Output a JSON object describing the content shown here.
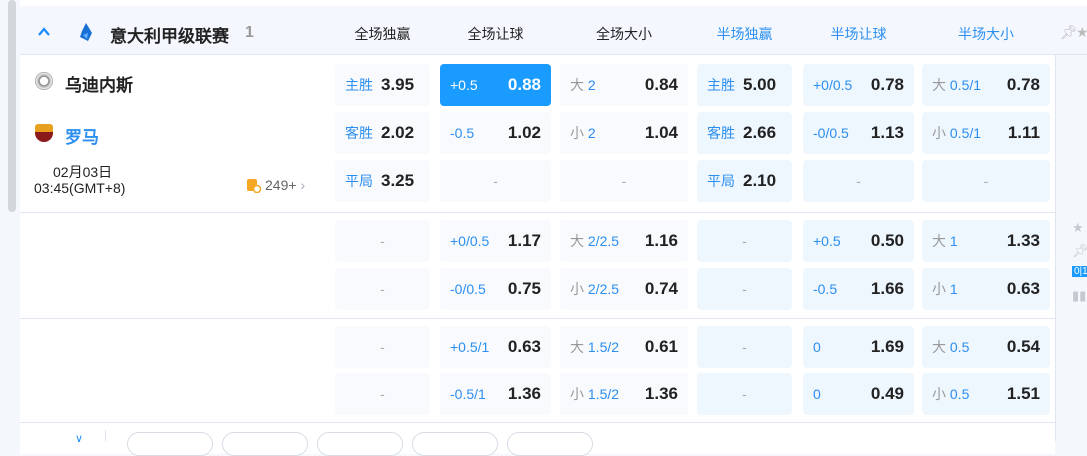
{
  "league": {
    "name": "意大利甲级联赛",
    "count": "1"
  },
  "columns": [
    "全场独赢",
    "全场让球",
    "全场大小",
    "半场独赢",
    "半场让球",
    "半场大小"
  ],
  "match": {
    "home": "乌迪内斯",
    "away": "罗马",
    "date": "02月03日",
    "time": "03:45(GMT+8)",
    "more_count": "249+"
  },
  "colors": {
    "accent": "#1a9bff",
    "label": "#2c8ff0",
    "away_team": "#2c8ff0"
  },
  "rows": [
    [
      {
        "lab": "主胜",
        "val": "3.95"
      },
      {
        "lab": "+0.5",
        "val": "0.88",
        "selected": true
      },
      {
        "pre": "大",
        "lab": "2",
        "val": "0.84"
      },
      {
        "lab": "主胜",
        "val": "5.00"
      },
      {
        "lab": "+0/0.5",
        "val": "0.78"
      },
      {
        "pre": "大",
        "lab": "0.5/1",
        "val": "0.78"
      }
    ],
    [
      {
        "lab": "客胜",
        "val": "2.02"
      },
      {
        "lab": "-0.5",
        "val": "1.02"
      },
      {
        "pre": "小",
        "lab": "2",
        "val": "1.04"
      },
      {
        "lab": "客胜",
        "val": "2.66"
      },
      {
        "lab": "-0/0.5",
        "val": "1.13"
      },
      {
        "pre": "小",
        "lab": "0.5/1",
        "val": "1.11"
      }
    ],
    [
      {
        "lab": "平局",
        "val": "3.25"
      },
      {
        "empty": "-"
      },
      {
        "empty": "-"
      },
      {
        "lab": "平局",
        "val": "2.10"
      },
      {
        "empty": "-"
      },
      {
        "empty": "-"
      }
    ],
    [
      {
        "empty": "-"
      },
      {
        "lab": "+0/0.5",
        "val": "1.17"
      },
      {
        "pre": "大",
        "lab": "2/2.5",
        "val": "1.16"
      },
      {
        "empty": "-"
      },
      {
        "lab": "+0.5",
        "val": "0.50"
      },
      {
        "pre": "大",
        "lab": "1",
        "val": "1.33"
      }
    ],
    [
      {
        "empty": "-"
      },
      {
        "lab": "-0/0.5",
        "val": "0.75"
      },
      {
        "pre": "小",
        "lab": "2/2.5",
        "val": "0.74"
      },
      {
        "empty": "-"
      },
      {
        "lab": "-0.5",
        "val": "1.66"
      },
      {
        "pre": "小",
        "lab": "1",
        "val": "0.63"
      }
    ],
    [
      {
        "empty": "-"
      },
      {
        "lab": "+0.5/1",
        "val": "0.63"
      },
      {
        "pre": "大",
        "lab": "1.5/2",
        "val": "0.61"
      },
      {
        "empty": "-"
      },
      {
        "lab": "0",
        "val": "1.69"
      },
      {
        "pre": "大",
        "lab": "0.5",
        "val": "0.54"
      }
    ],
    [
      {
        "empty": "-"
      },
      {
        "lab": "-0.5/1",
        "val": "1.36"
      },
      {
        "pre": "小",
        "lab": "1.5/2",
        "val": "1.36"
      },
      {
        "empty": "-"
      },
      {
        "lab": "0",
        "val": "0.49"
      },
      {
        "pre": "小",
        "lab": "0.5",
        "val": "1.51"
      }
    ]
  ],
  "side_icons": [
    "pin-icon",
    "star-icon",
    "pin-icon",
    "score-icon",
    "stats-icon"
  ]
}
